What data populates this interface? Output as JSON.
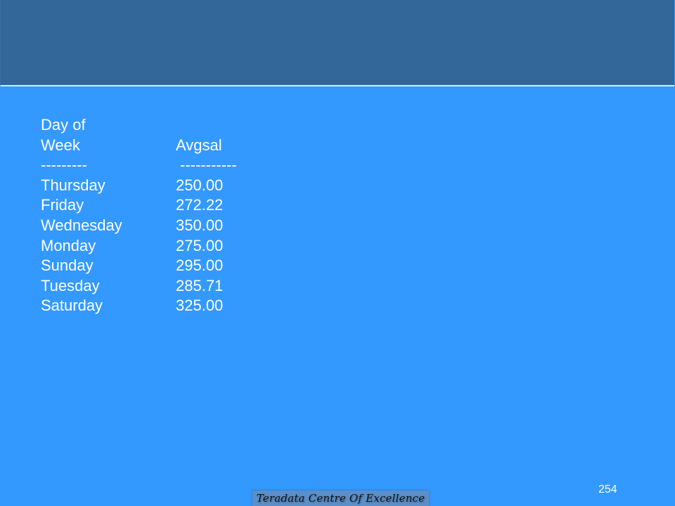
{
  "slide": {
    "header_color": "#336699",
    "background_color": "#3399ff"
  },
  "table": {
    "header_line1": {
      "col1": "Day of",
      "col2": ""
    },
    "header_line2": {
      "col1": "Week",
      "col2": "Avgsal"
    },
    "separator": {
      "col1": "---------",
      "col2": " -----------"
    },
    "rows": [
      {
        "day": "Thursday",
        "avgsal": "250.00"
      },
      {
        "day": "Friday",
        "avgsal": "272.22"
      },
      {
        "day": "Wednesday",
        "avgsal": "350.00"
      },
      {
        "day": "Monday",
        "avgsal": "275.00"
      },
      {
        "day": "Sunday",
        "avgsal": "295.00"
      },
      {
        "day": "Tuesday",
        "avgsal": "285.71"
      },
      {
        "day": "Saturday",
        "avgsal": "325.00"
      }
    ]
  },
  "footer": {
    "label": "Teradata Centre Of Excellence",
    "page_number": "254"
  }
}
